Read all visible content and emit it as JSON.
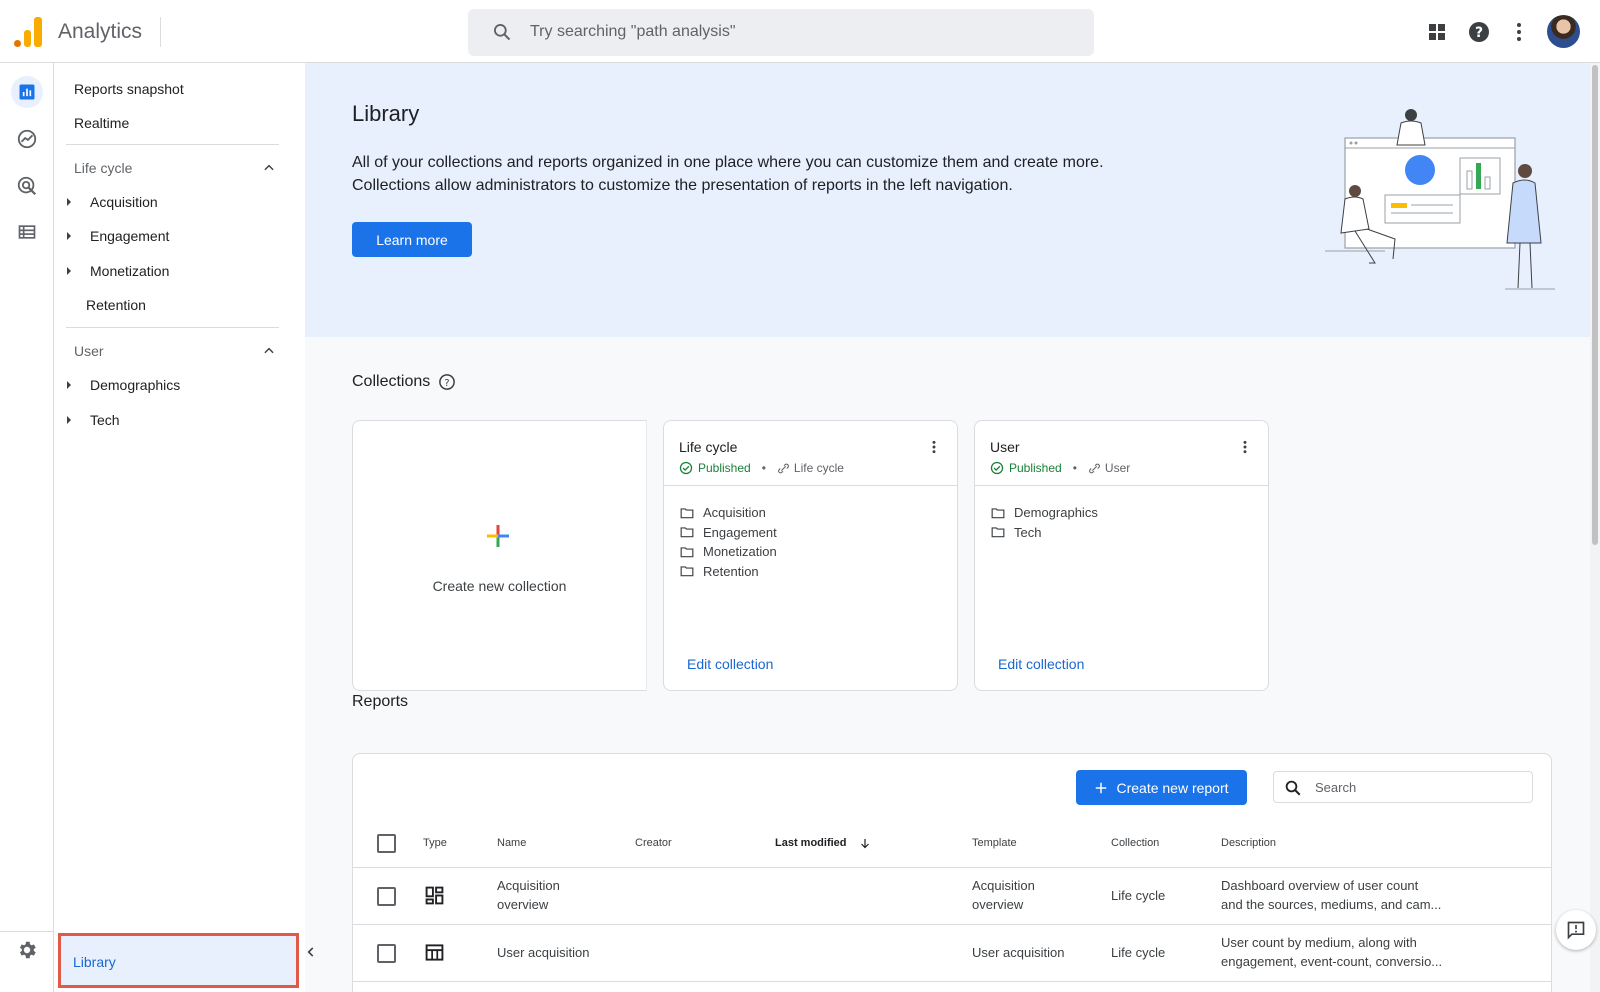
{
  "app": {
    "name": "Analytics"
  },
  "search": {
    "placeholder": "Try searching \"path analysis\""
  },
  "topbar": {
    "icons": [
      "apps-grid-icon",
      "help-icon",
      "more-vert-icon",
      "account-avatar"
    ]
  },
  "rail": {
    "items": [
      "reports-icon",
      "explore-icon",
      "advertising-icon",
      "configure-icon"
    ],
    "settings": "settings-gear-icon"
  },
  "nav": {
    "reports_snapshot": "Reports snapshot",
    "realtime": "Realtime",
    "lifecycle": {
      "label": "Life cycle",
      "items": [
        "Acquisition",
        "Engagement",
        "Monetization",
        "Retention"
      ]
    },
    "user": {
      "label": "User",
      "items": [
        "Demographics",
        "Tech"
      ]
    },
    "library": "Library"
  },
  "hero": {
    "title": "Library",
    "line1": "All of your collections and reports organized in one place where you can customize them and create more.",
    "line2": "Collections allow administrators to customize the presentation of reports in the left navigation.",
    "learn_more": "Learn more"
  },
  "collections": {
    "title": "Collections",
    "create_label": "Create new collection",
    "cards": [
      {
        "title": "Life cycle",
        "status": "Published",
        "source": "Life cycle",
        "items": [
          "Acquisition",
          "Engagement",
          "Monetization",
          "Retention"
        ],
        "edit": "Edit collection"
      },
      {
        "title": "User",
        "status": "Published",
        "source": "User",
        "items": [
          "Demographics",
          "Tech"
        ],
        "edit": "Edit collection"
      }
    ]
  },
  "reports": {
    "title": "Reports",
    "create_button": "Create new report",
    "search_placeholder": "Search",
    "columns": [
      "Type",
      "Name",
      "Creator",
      "Last modified",
      "Template",
      "Collection",
      "Description"
    ],
    "rows": [
      {
        "type_icon": "dashboard-icon",
        "name_1": "Acquisition",
        "name_2": "overview",
        "creator": "",
        "template_1": "Acquisition",
        "template_2": "overview",
        "collection": "Life cycle",
        "desc_1": "Dashboard overview of user count",
        "desc_2": "and the sources, mediums, and cam..."
      },
      {
        "type_icon": "table-icon",
        "name_1": "User acquisition",
        "creator": "",
        "template_1": "User acquisition",
        "collection": "Life cycle",
        "desc_1": "User count by medium, along with",
        "desc_2": "engagement, event-count, conversio..."
      }
    ]
  },
  "colors": {
    "accent": "#1a73e8",
    "highlight_border": "#e05a47",
    "hero_bg": "#e8f0fe",
    "published": "#188038"
  }
}
